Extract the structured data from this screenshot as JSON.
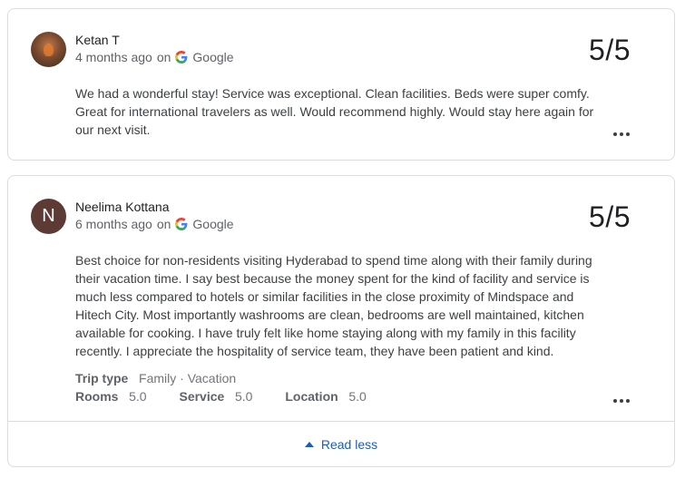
{
  "reviews": [
    {
      "author": "Ketan T",
      "time": "4 months ago",
      "on_label": "on",
      "source": "Google",
      "score": "5/5",
      "text": "We had a wonderful stay! Service was exceptional. Clean facilities. Beds were super comfy. Great for international travelers as well. Would recommend highly. Would stay here again for our next visit."
    },
    {
      "author": "Neelima Kottana",
      "avatar_letter": "N",
      "time": "6 months ago",
      "on_label": "on",
      "source": "Google",
      "score": "5/5",
      "text": "Best choice for non-residents visiting Hyderabad to spend time along with their family during their vacation time. I say best because the money spent for the kind of facility and service is much less compared to hotels or similar facilities in the close proximity of Mindspace and Hitech City. Most importantly washrooms are clean, bedrooms are well maintained, kitchen available for cooking. I have truly felt like home staying along with my family in this facility recently. I appreciate the hospitality of service team, they have been patient and kind.",
      "trip_type_label": "Trip type",
      "trip_type_value": "Family · Vacation",
      "ratings": [
        {
          "label": "Rooms",
          "value": "5.0"
        },
        {
          "label": "Service",
          "value": "5.0"
        },
        {
          "label": "Location",
          "value": "5.0"
        }
      ]
    }
  ],
  "read_less_label": "Read less",
  "colors": {
    "link": "#1a5fb4",
    "avatar_letter_bg": "#5d3a33",
    "border": "#dadce0"
  },
  "icons": [
    "google-g-icon",
    "more-options-icon",
    "caret-up-icon"
  ]
}
